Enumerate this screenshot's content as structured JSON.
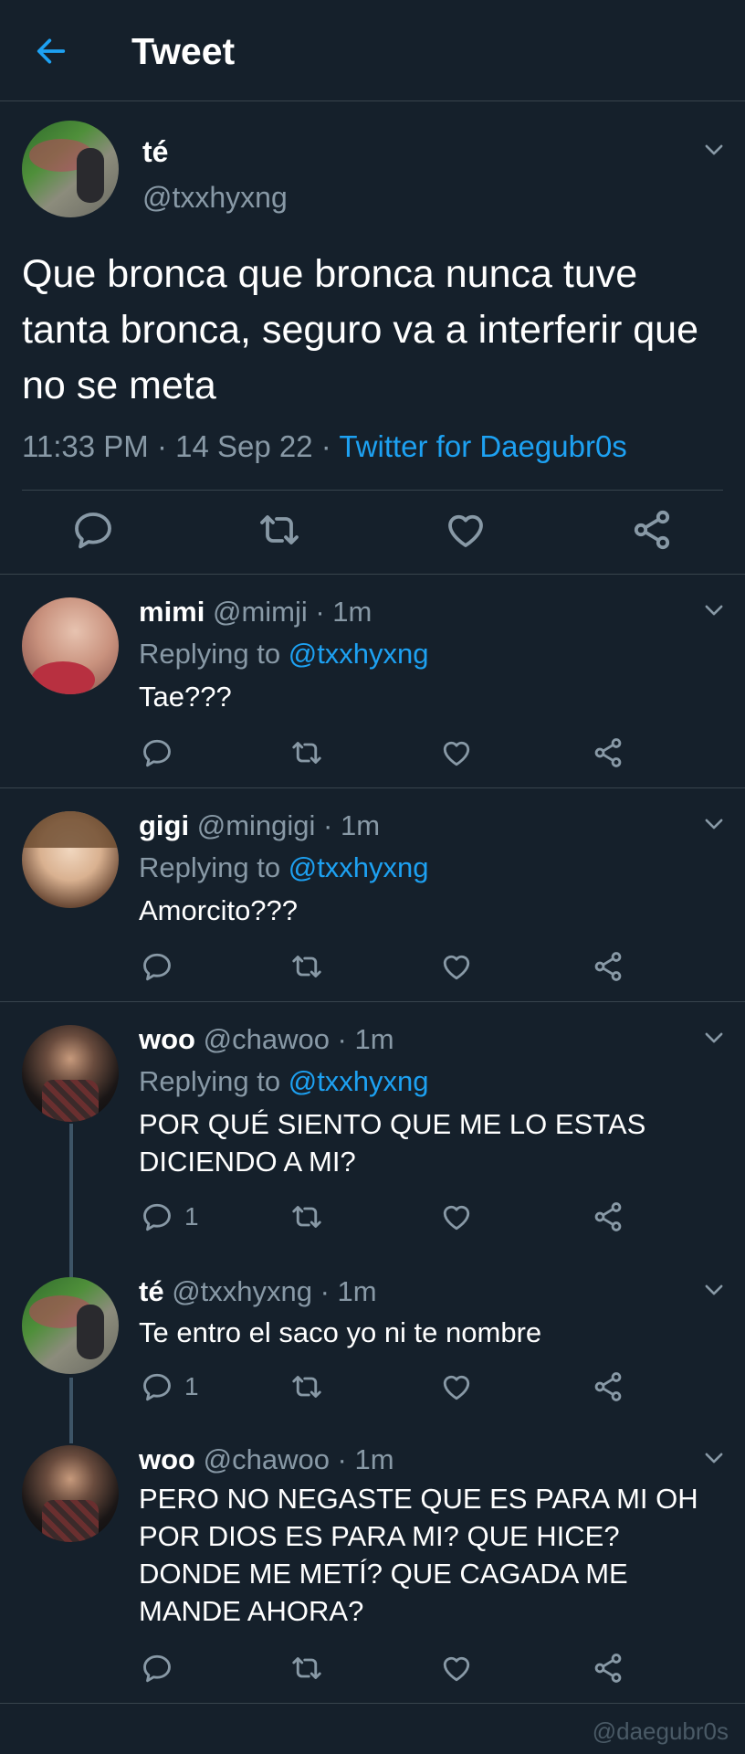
{
  "header": {
    "title": "Tweet",
    "back_icon": "arrow-left-icon",
    "accent": "#1da1f2"
  },
  "main_tweet": {
    "name": "té",
    "handle": "@txxhyxng",
    "text": "Que bronca que bronca nunca tuve tanta bronca, seguro va a interferir que no se meta",
    "time": "11:33 PM · 14 Sep 22 · ",
    "source": "Twitter for Daegubr0s"
  },
  "replies": [
    {
      "name": "mimi",
      "meta": "@mimji · 1m",
      "replying_label": "Replying to ",
      "replying_handle": "@txxhyxng",
      "text": "Tae???",
      "reply_count": ""
    },
    {
      "name": "gigi",
      "meta": "@mingigi · 1m",
      "replying_label": "Replying to ",
      "replying_handle": "@txxhyxng",
      "text": "Amorcito???",
      "reply_count": ""
    },
    {
      "name": "woo",
      "meta": "@chawoo · 1m",
      "replying_label": "Replying to ",
      "replying_handle": "@txxhyxng",
      "text": "POR QUÉ SIENTO QUE ME LO ESTAS DICIENDO A MI?",
      "reply_count": "1"
    },
    {
      "name": "té",
      "meta": "@txxhyxng · 1m",
      "text": "Te entro el saco yo ni te nombre",
      "reply_count": "1"
    },
    {
      "name": "woo",
      "meta": "@chawoo · 1m",
      "text": "PERO NO NEGASTE QUE ES PARA MI OH POR DIOS ES PARA MI? QUE HICE? DONDE ME METÍ? QUE CAGADA ME MANDE AHORA?",
      "reply_count": ""
    }
  ],
  "watermark": "@daegubr0s"
}
